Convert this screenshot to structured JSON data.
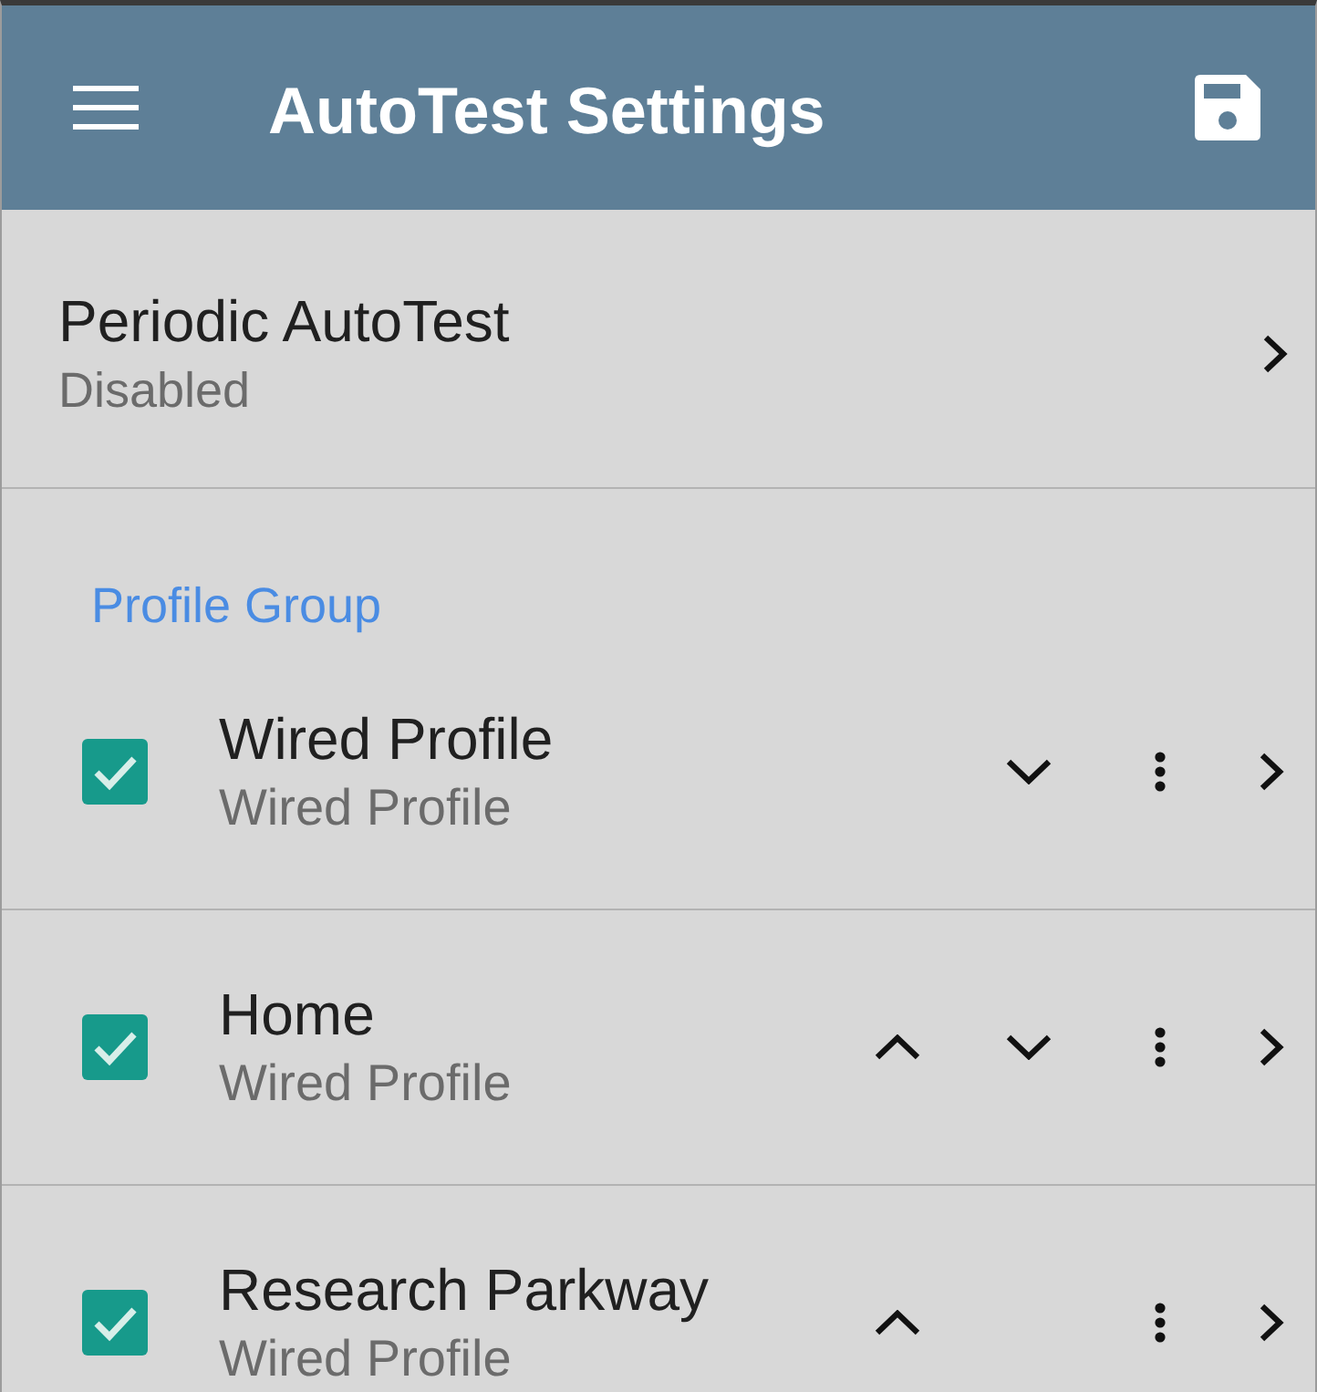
{
  "app_bar": {
    "title": "AutoTest Settings"
  },
  "periodic_autotest": {
    "title": "Periodic AutoTest",
    "status": "Disabled"
  },
  "profile_group": {
    "heading": "Profile Group",
    "profiles": [
      {
        "name": "Wired Profile",
        "type": "Wired Profile",
        "checked": true,
        "can_move_up": false,
        "can_move_down": true
      },
      {
        "name": "Home",
        "type": "Wired Profile",
        "checked": true,
        "can_move_up": true,
        "can_move_down": true
      },
      {
        "name": "Research Parkway",
        "type": "Wired Profile",
        "checked": true,
        "can_move_up": true,
        "can_move_down": false
      }
    ]
  }
}
